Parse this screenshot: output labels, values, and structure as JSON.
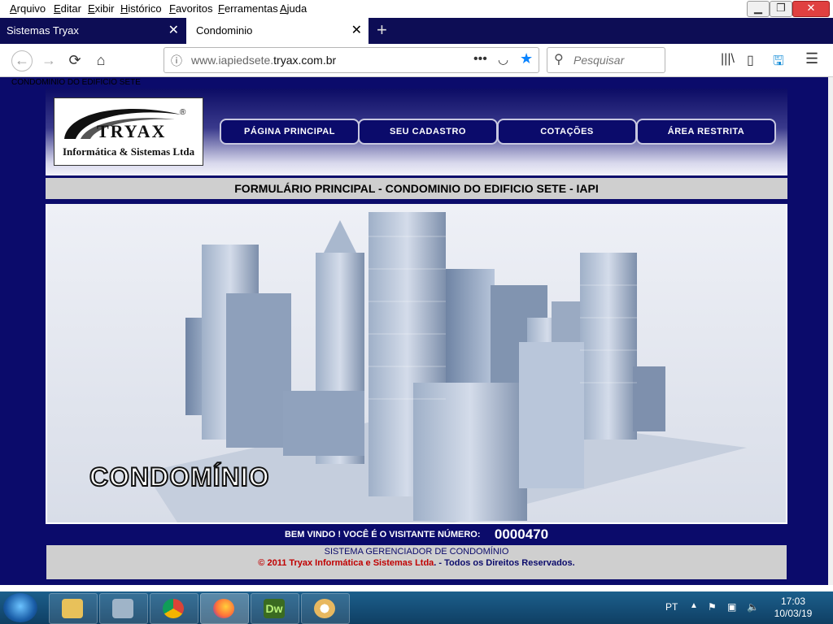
{
  "menubar": [
    "Arquivo",
    "Editar",
    "Exibir",
    "Histórico",
    "Favoritos",
    "Ferramentas",
    "Ajuda"
  ],
  "window_controls": {
    "minimize": "▁",
    "restore": "❐",
    "close": "✕"
  },
  "tabs": [
    {
      "label": "Sistemas Tryax",
      "close": "✕"
    },
    {
      "label": "Condominio",
      "close": "✕"
    }
  ],
  "new_tab": "+",
  "nav": {
    "back": "←",
    "forward": "→",
    "reload": "⟳",
    "home": "⌂"
  },
  "url": {
    "prefix": "www.iapiedsete.",
    "domain": "tryax.com.br",
    "info_icon": "ⓘ",
    "dots": "•••",
    "pocket": "◡",
    "star": "★"
  },
  "search": {
    "placeholder": "Pesquisar",
    "icon": "⚲"
  },
  "toolbar_icons": [
    "|||\\",
    "▯",
    "🖫",
    "☰"
  ],
  "page_title_small": "CONDOMINIO DO EDIFICIO SETE",
  "logo": {
    "brand": "TRYAX",
    "reg": "®",
    "tagline": "Informática & Sistemas Ltda"
  },
  "menu": [
    "PÁGINA PRINCIPAL",
    "SEU CADASTRO",
    "COTAÇÕES",
    "ÁREA RESTRITA"
  ],
  "form_title": "FORMULÁRIO PRINCIPAL - CONDOMINIO DO EDIFICIO SETE - IAPI",
  "banner_text": "CONDOMÍNIO",
  "visitor": {
    "label": "BEM VINDO ! VOCÊ É O VISITANTE NÚMERO:",
    "number": "0000470"
  },
  "footer": {
    "line1": "SISTEMA GERENCIADOR DE CONDOMÍNIO",
    "line2_red": "© 2011 Tryax Informática e Sistemas Ltda",
    "line2_blue": ". - Todos os Direitos Reservados."
  },
  "taskbar": {
    "lang": "PT",
    "time": "17:03",
    "date": "10/03/19"
  },
  "colors": {
    "navy": "#0b0b6b",
    "tab_bar": "#0d0d55",
    "accent": "#0a84ff",
    "footer_red": "#c00000"
  }
}
